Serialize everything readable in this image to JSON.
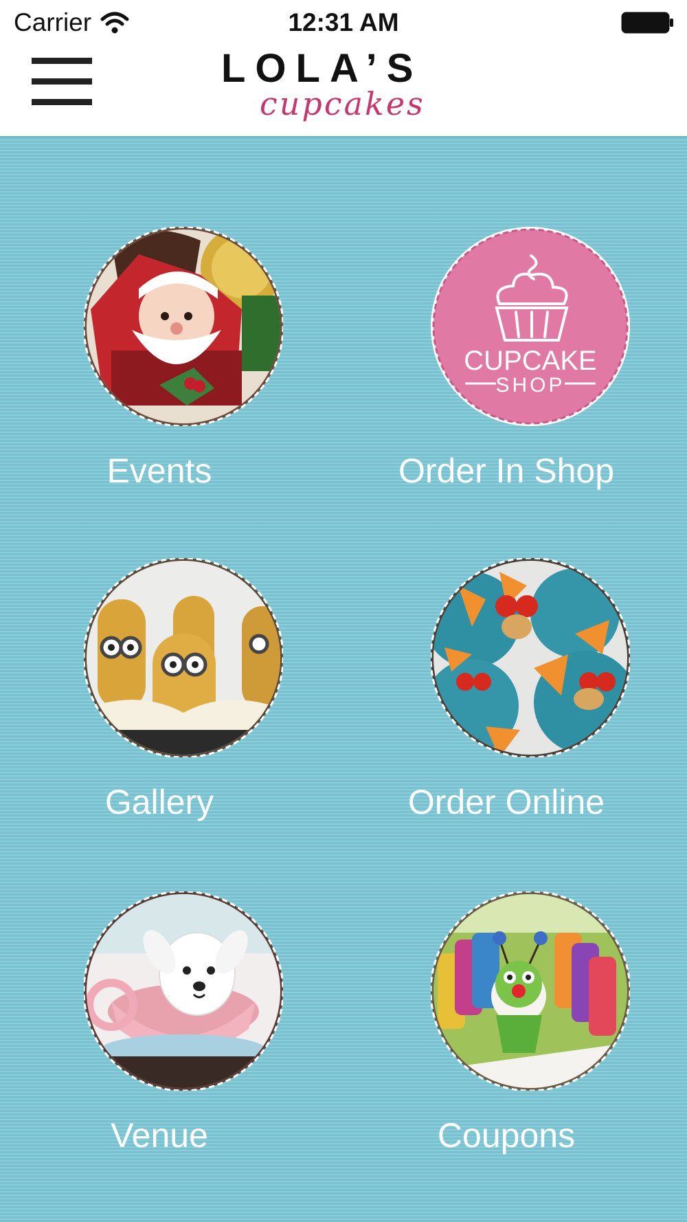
{
  "status_bar": {
    "carrier": "Carrier",
    "time": "12:31 AM",
    "wifi_icon": "wifi-icon",
    "battery_icon": "battery-full-icon"
  },
  "header": {
    "menu_icon": "hamburger-menu-icon",
    "logo_main": "LOLA’S",
    "logo_sub": "cupcakes"
  },
  "colors": {
    "background": "#7ec7d6",
    "label_text": "#ffffff",
    "logo_pink": "#c5386f",
    "cupcake_shop_pink": "#e07aa4"
  },
  "tiles": [
    {
      "label": "Events",
      "image": "santa-cupcake-image"
    },
    {
      "label": "Order In Shop",
      "image": "cupcake-shop-logo-image",
      "badge_line1": "CUPCAKE",
      "badge_line2": "SHOP"
    },
    {
      "label": "Gallery",
      "image": "minion-cupcakes-image"
    },
    {
      "label": "Order Online",
      "image": "fish-cupcakes-image"
    },
    {
      "label": "Venue",
      "image": "puppy-teacup-cupcake-image"
    },
    {
      "label": "Coupons",
      "image": "caterpillar-cupcakes-image"
    }
  ]
}
